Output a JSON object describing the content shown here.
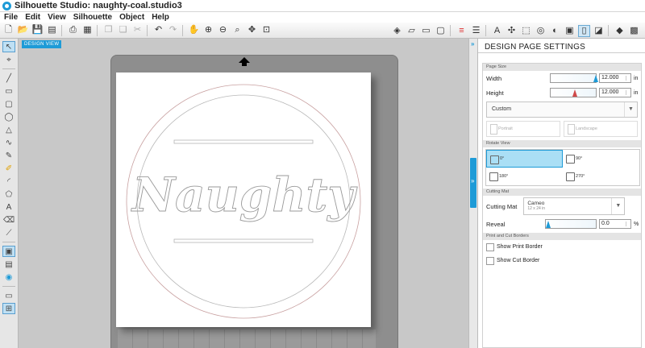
{
  "window": {
    "title": "Silhouette Studio: naughty-coal.studio3"
  },
  "menu": [
    "File",
    "Edit",
    "View",
    "Silhouette",
    "Object",
    "Help"
  ],
  "toolbar_icons": [
    "new-icon",
    "open-icon",
    "save-icon",
    "save-as-icon",
    "print-icon",
    "cut-print-icon",
    "copy-icon",
    "paste-icon",
    "cut-icon",
    "undo-icon",
    "redo-icon",
    "pan-icon",
    "zoom-in-icon",
    "zoom-out-icon",
    "zoom-select-icon",
    "drag-icon",
    "fit-page-icon"
  ],
  "right_toolbar_icons": [
    "fill-icon",
    "line-color-icon",
    "line-style-icon",
    "line-width-icon",
    "cut-style-icon",
    "align-icon",
    "text-style-icon",
    "replicate-icon",
    "modify-icon",
    "offset-icon",
    "trace-icon",
    "design-page-icon",
    "cut-settings-icon",
    "send-icon",
    "library-icon"
  ],
  "left_tools": [
    "select-icon",
    "point-edit-icon",
    "line-icon",
    "rectangle-icon",
    "rounded-rectangle-icon",
    "ellipse-icon",
    "polygon-icon",
    "curve-icon",
    "freehand-icon",
    "smooth-freehand-icon",
    "arc-icon",
    "regular-polygon-icon",
    "text-icon",
    "eraser-icon",
    "knife-icon",
    "design-view-icon",
    "library-view-icon",
    "store-icon",
    "page-icon",
    "split-view-icon"
  ],
  "design_view_label": "DESIGN VIEW",
  "artwork_text": "Naughty",
  "panel": {
    "title": "DESIGN PAGE SETTINGS",
    "page_size": {
      "section": "Page Size",
      "width_label": "Width",
      "width_value": "12.000",
      "height_label": "Height",
      "height_value": "12.000",
      "unit": "in",
      "preset": "Custom",
      "portrait": "Portrait",
      "landscape": "Landscape"
    },
    "rotate_view": {
      "section": "Rotate View",
      "options": [
        "0°",
        "90°",
        "180°",
        "270°"
      ],
      "selected": "0°"
    },
    "cutting_mat": {
      "section": "Cutting Mat",
      "label": "Cutting Mat",
      "value": "Cameo",
      "sub": "12 x 24 in",
      "reveal_label": "Reveal",
      "reveal_value": "0.0",
      "reveal_unit": "%"
    },
    "print_cut": {
      "section": "Print and Cut Borders",
      "show_print": "Show Print Border",
      "show_cut": "Show Cut Border"
    }
  }
}
